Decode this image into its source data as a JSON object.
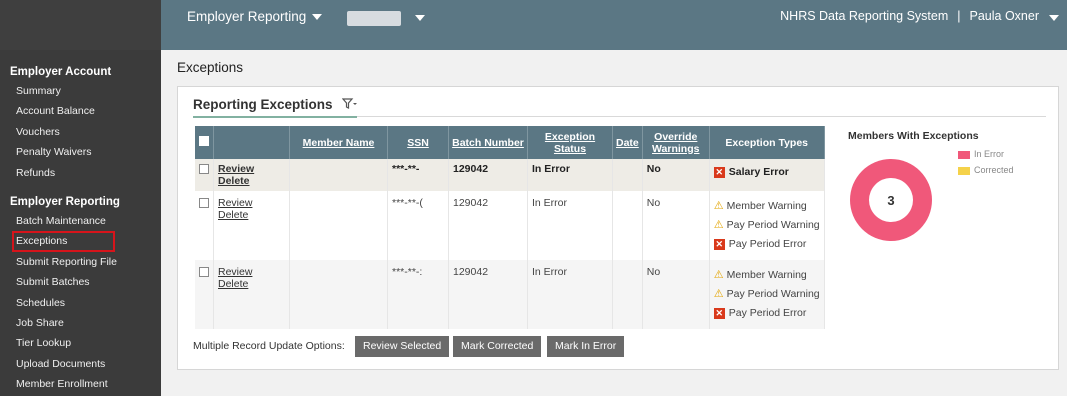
{
  "header": {
    "menu_label": "Employer Reporting",
    "system_name": "NHRS Data Reporting System",
    "separator": "|",
    "user_name": "Paula Oxner"
  },
  "sidebar": {
    "section_account": "Employer Account",
    "account_items": [
      "Summary",
      "Account Balance",
      "Vouchers",
      "Penalty Waivers",
      "Refunds"
    ],
    "section_reporting": "Employer Reporting",
    "reporting_items": [
      "Batch Maintenance",
      "Exceptions",
      "Submit Reporting File",
      "Submit Batches",
      "Schedules",
      "Job Share",
      "Tier Lookup",
      "Upload Documents",
      "Member Enrollment"
    ]
  },
  "page": {
    "title": "Exceptions",
    "panel_title": "Reporting Exceptions",
    "filter_icon": "filter-icon"
  },
  "table": {
    "columns": [
      "Member Name",
      "SSN",
      "Batch Number",
      "Exception Status",
      "Date",
      "Override Warnings",
      "Exception Types"
    ],
    "review_label": "Review",
    "delete_label": "Delete",
    "rows": [
      {
        "ssn": "***-**-",
        "batch": "129042",
        "status": "In Error",
        "override": "No",
        "exceptions": [
          {
            "type": "error",
            "label": "Salary Error"
          }
        ]
      },
      {
        "ssn": "***-**-(",
        "batch": "129042",
        "status": "In Error",
        "override": "No",
        "exceptions": [
          {
            "type": "warning",
            "label": "Member Warning"
          },
          {
            "type": "warning",
            "label": "Pay Period Warning"
          },
          {
            "type": "error",
            "label": "Pay Period Error"
          }
        ]
      },
      {
        "ssn": "***-**-:",
        "batch": "129042",
        "status": "In Error",
        "override": "No",
        "exceptions": [
          {
            "type": "warning",
            "label": "Member Warning"
          },
          {
            "type": "warning",
            "label": "Pay Period Warning"
          },
          {
            "type": "error",
            "label": "Pay Period Error"
          }
        ]
      }
    ]
  },
  "actions": {
    "label": "Multiple Record Update Options:",
    "review_selected": "Review Selected",
    "mark_corrected": "Mark Corrected",
    "mark_in_error": "Mark In Error"
  },
  "chart_data": {
    "type": "pie",
    "title": "Members With Exceptions",
    "categories": [
      "In Error",
      "Corrected"
    ],
    "values": [
      3,
      0
    ],
    "center_label": "3",
    "colors": {
      "In Error": "#f0587a",
      "Corrected": "#f5d24a"
    },
    "legend_position": "top-right"
  },
  "colors": {
    "topbar": "#5b7784",
    "sidebar": "#3b3b3b",
    "active_outline": "#d6141b",
    "button": "#6a6a6a"
  }
}
